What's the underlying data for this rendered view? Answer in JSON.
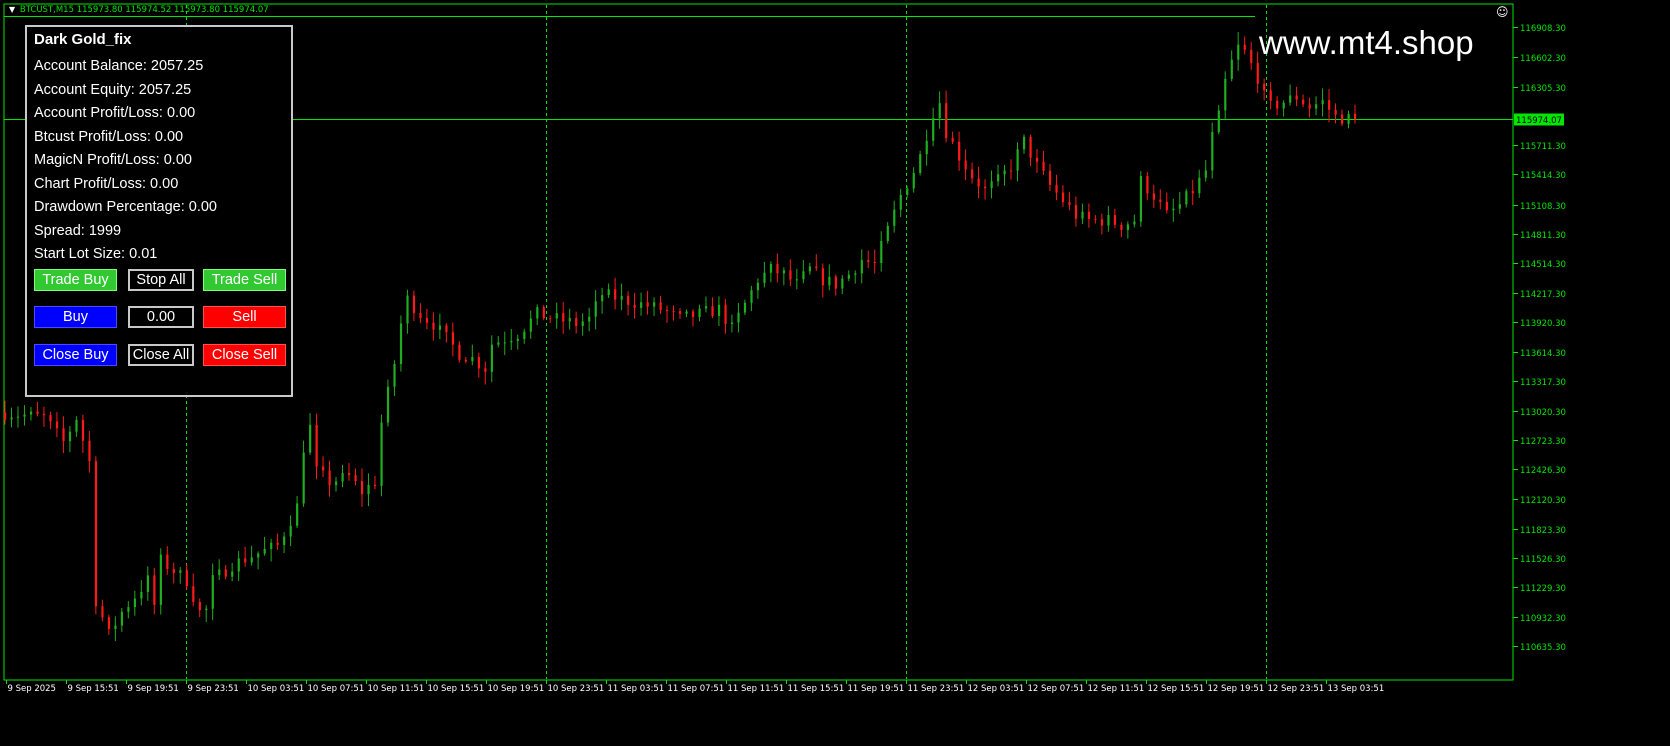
{
  "chart_header": {
    "symbol_timeframe": "BTCUST,M15",
    "ohlc": "115973.80 115974.52 115973.80 115974.07"
  },
  "watermark": "www.mt4.shop",
  "panel": {
    "title": "Dark Gold_fix",
    "lines": [
      "Account Balance: 2057.25",
      "Account Equity: 2057.25",
      "Account Profit/Loss: 0.00",
      "Btcust Profit/Loss: 0.00",
      "MagicN Profit/Loss: 0.00",
      "Chart Profit/Loss: 0.00",
      "Drawdown Percentage: 0.00",
      "Spread: 1999",
      "Start Lot Size: 0.01"
    ],
    "buttons": {
      "trade_buy": "Trade Buy",
      "stop_all": "Stop All",
      "trade_sell": "Trade Sell",
      "buy": "Buy",
      "lot_value": "0.00",
      "sell": "Sell",
      "close_buy": "Close Buy",
      "close_all": "Close All",
      "close_sell": "Close Sell"
    }
  },
  "chart_data": {
    "type": "candlestick",
    "symbol": "BTCUST",
    "timeframe": "M15",
    "current_price": 115974.07,
    "y_ticks": [
      "116908.30",
      "116602.30",
      "116305.30",
      "115711.30",
      "115414.30",
      "115108.30",
      "114811.30",
      "114514.30",
      "114217.30",
      "113920.30",
      "113614.30",
      "113317.30",
      "113020.30",
      "112723.30",
      "112426.30",
      "112120.30",
      "111823.30",
      "111526.30",
      "111229.30",
      "110932.30",
      "110635.30"
    ],
    "x_ticks": [
      "9 Sep 2025",
      "9 Sep 15:51",
      "9 Sep 19:51",
      "9 Sep 23:51",
      "10 Sep 03:51",
      "10 Sep 07:51",
      "10 Sep 11:51",
      "10 Sep 15:51",
      "10 Sep 19:51",
      "10 Sep 23:51",
      "11 Sep 03:51",
      "11 Sep 07:51",
      "11 Sep 11:51",
      "11 Sep 15:51",
      "11 Sep 19:51",
      "11 Sep 23:51",
      "12 Sep 03:51",
      "12 Sep 07:51",
      "12 Sep 11:51",
      "12 Sep 15:51",
      "12 Sep 19:51",
      "12 Sep 23:51",
      "13 Sep 03:51"
    ],
    "day_separators": [
      "9 Sep 23:51",
      "10 Sep 23:51",
      "11 Sep 23:51",
      "12 Sep 23:51"
    ],
    "close_path": [
      [
        0,
        113000
      ],
      [
        6,
        112950
      ],
      [
        9,
        112700
      ],
      [
        11,
        112950
      ],
      [
        13,
        112500
      ],
      [
        14,
        111100
      ],
      [
        16,
        110750
      ],
      [
        18,
        110980
      ],
      [
        22,
        111300
      ],
      [
        23,
        111050
      ],
      [
        24,
        111500
      ],
      [
        26,
        111400
      ],
      [
        28,
        111300
      ],
      [
        30,
        110980
      ],
      [
        31,
        111000
      ],
      [
        32,
        111300
      ],
      [
        35,
        111460
      ],
      [
        38,
        111550
      ],
      [
        42,
        111650
      ],
      [
        45,
        112050
      ],
      [
        46,
        112650
      ],
      [
        47,
        112850
      ],
      [
        48,
        112400
      ],
      [
        50,
        112300
      ],
      [
        53,
        112350
      ],
      [
        55,
        112200
      ],
      [
        57,
        112300
      ],
      [
        58,
        112900
      ],
      [
        60,
        113500
      ],
      [
        61,
        113900
      ],
      [
        62,
        114150
      ],
      [
        64,
        114000
      ],
      [
        66,
        113900
      ],
      [
        68,
        113750
      ],
      [
        70,
        113600
      ],
      [
        72,
        113550
      ],
      [
        74,
        113450
      ],
      [
        75,
        113700
      ],
      [
        77,
        113750
      ],
      [
        79,
        113800
      ],
      [
        82,
        114000
      ],
      [
        85,
        113950
      ],
      [
        88,
        113900
      ],
      [
        90,
        113950
      ],
      [
        92,
        114200
      ],
      [
        95,
        114150
      ],
      [
        98,
        114100
      ],
      [
        101,
        114050
      ],
      [
        104,
        113950
      ],
      [
        107,
        114000
      ],
      [
        110,
        114050
      ],
      [
        112,
        113850
      ],
      [
        114,
        114100
      ],
      [
        116,
        114350
      ],
      [
        118,
        114450
      ],
      [
        120,
        114400
      ],
      [
        122,
        114300
      ],
      [
        124,
        114450
      ],
      [
        126,
        114350
      ],
      [
        128,
        114300
      ],
      [
        130,
        114400
      ],
      [
        132,
        114550
      ],
      [
        134,
        114500
      ],
      [
        136,
        114850
      ],
      [
        138,
        115200
      ],
      [
        140,
        115450
      ],
      [
        141,
        115600
      ],
      [
        143,
        116050
      ],
      [
        144,
        116150
      ],
      [
        145,
        115850
      ],
      [
        147,
        115600
      ],
      [
        149,
        115400
      ],
      [
        151,
        115250
      ],
      [
        153,
        115350
      ],
      [
        155,
        115500
      ],
      [
        157,
        115750
      ],
      [
        159,
        115500
      ],
      [
        161,
        115300
      ],
      [
        163,
        115150
      ],
      [
        165,
        115000
      ],
      [
        167,
        114950
      ],
      [
        170,
        114950
      ],
      [
        172,
        114900
      ],
      [
        174,
        114950
      ],
      [
        175,
        115350
      ],
      [
        177,
        115200
      ],
      [
        179,
        115000
      ],
      [
        181,
        115100
      ],
      [
        183,
        115250
      ],
      [
        185,
        115450
      ],
      [
        186,
        115800
      ],
      [
        187,
        116000
      ],
      [
        188,
        116350
      ],
      [
        189,
        116550
      ],
      [
        190,
        116700
      ],
      [
        191,
        116650
      ],
      [
        193,
        116400
      ],
      [
        194,
        116200
      ],
      [
        195,
        116100
      ],
      [
        197,
        116150
      ],
      [
        199,
        116200
      ],
      [
        201,
        116100
      ],
      [
        203,
        116150
      ],
      [
        205,
        116000
      ],
      [
        207,
        115980
      ],
      [
        208,
        115974.07
      ]
    ]
  }
}
